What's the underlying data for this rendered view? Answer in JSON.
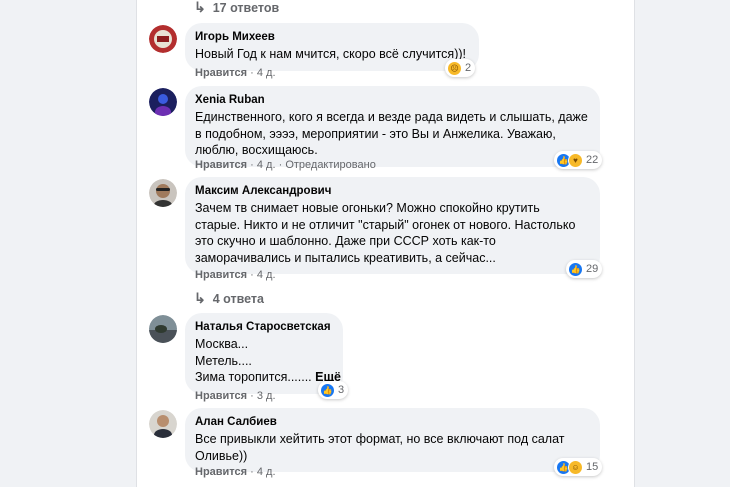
{
  "thread": {
    "replies_top": "17 ответов",
    "replies_mid": "4 ответа",
    "comments": [
      {
        "author": "Игорь Михеев",
        "lines": [
          "Новый Год к нам мчится, скоро всё случится))!"
        ],
        "like": "Нравится",
        "time": "4 д.",
        "reaction_count": "2",
        "reaction_icons": [
          "sad-reaction-icon"
        ]
      },
      {
        "author": "Xenia Ruban",
        "lines": [
          "Единственного, кого я всегда и везде рада видеть и слышать, даже",
          "в подобном, ээээ, мероприятии - это Вы и Анжелика. Уважаю,",
          "люблю, восхищаюсь."
        ],
        "like": "Нравится",
        "time": "4 д.",
        "edited": "Отредактировано",
        "reaction_count": "22",
        "reaction_icons": [
          "like-reaction-icon",
          "care-reaction-icon"
        ]
      },
      {
        "author": "Максим Александрович",
        "lines": [
          "Зачем тв снимает новые огоньки? Можно спокойно крутить",
          "старые. Никто и не отличит \"старый\" огонек от нового. Настолько",
          "это скучно и шаблонно. Даже при СССР хоть как-то",
          "заморачивались и пытались креативить, а сейчас..."
        ],
        "like": "Нравится",
        "time": "4 д.",
        "reaction_count": "29",
        "reaction_icons": [
          "like-reaction-icon"
        ]
      },
      {
        "author": "Наталья Старосветская",
        "lines": [
          "Москва...",
          "Метель....",
          "Зима торопится......."
        ],
        "more": "Ещё",
        "like": "Нравится",
        "time": "3 д.",
        "reaction_count": "3",
        "reaction_icons": [
          "like-reaction-icon"
        ]
      },
      {
        "author": "Алан Салбиев",
        "lines": [
          "Все привыкли хейтить этот формат, но все включают под салат",
          "Оливье))"
        ],
        "like": "Нравится",
        "time": "4 д.",
        "reaction_count": "15",
        "reaction_icons": [
          "like-reaction-icon",
          "wow-reaction-icon"
        ]
      }
    ]
  },
  "colors": {
    "page_bg": "#f0f2f5",
    "bubble_bg": "#f0f2f5",
    "secondary_text": "#65676b",
    "like_blue": "#1877f2",
    "reaction_yellow": "#f7b928"
  }
}
